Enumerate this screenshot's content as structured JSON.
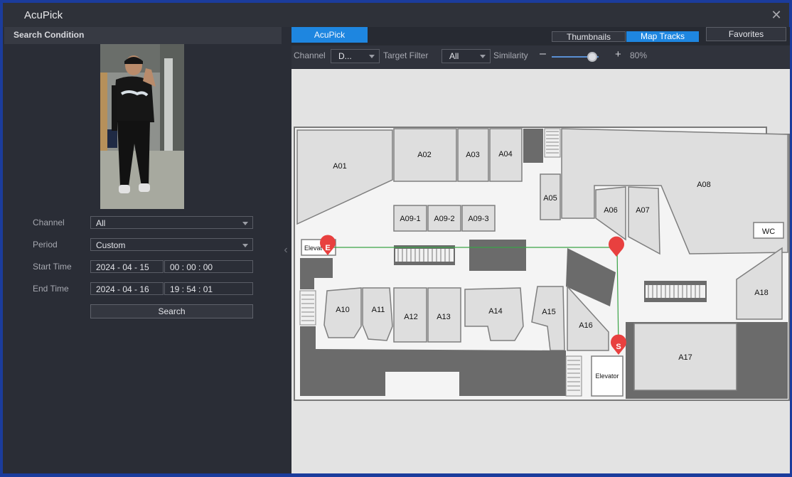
{
  "window": {
    "title": "AcuPick"
  },
  "left_panel": {
    "header": "Search Condition",
    "form": {
      "channel_label": "Channel",
      "channel_value": "All",
      "period_label": "Period",
      "period_value": "Custom",
      "start_label": "Start Time",
      "start_date": "2024 - 04 - 15",
      "start_time": "00 : 00 : 00",
      "end_label": "End Time",
      "end_date": "2024 - 04 - 16",
      "end_time": "19 : 54 : 01",
      "search_label": "Search"
    }
  },
  "right_panel": {
    "tab": "AcuPick",
    "view_thumbnails": "Thumbnails",
    "view_map_tracks": "Map Tracks",
    "favorites": "Favorites",
    "toolbar": {
      "channel_label": "Channel",
      "channel_value": "D...",
      "target_label": "Target Filter",
      "target_value": "All",
      "similarity_label": "Similarity",
      "similarity_percent": "80%",
      "similarity_value": 80
    }
  },
  "map": {
    "rooms": [
      "A01",
      "A02",
      "A03",
      "A04",
      "A05",
      "A06",
      "A07",
      "A08",
      "A09-1",
      "A09-2",
      "A09-3",
      "A10",
      "A11",
      "A12",
      "A13",
      "A14",
      "A15",
      "A16",
      "A17",
      "A18"
    ],
    "wc": "WC",
    "elevator_left": "Elevat",
    "elevator_right": "Elevator",
    "marker_start": "S",
    "marker_end": "E"
  },
  "colors": {
    "accent": "#1e86e0",
    "track": "#3aa346",
    "marker": "#e8403f"
  }
}
